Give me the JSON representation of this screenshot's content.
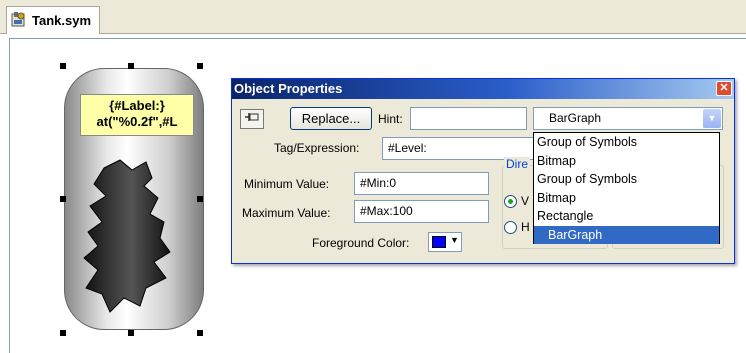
{
  "tab": {
    "title": "Tank.sym",
    "icon": "symbol-file-icon"
  },
  "symbol": {
    "label_line1": "{#Label:}",
    "label_line2": "at(\"%0.2f\",#L"
  },
  "dialog": {
    "title": "Object Properties",
    "replace_label": "Replace...",
    "hint_label": "Hint:",
    "hint_value": "",
    "object_type": "BarGraph",
    "tag_label": "Tag/Expression:",
    "tag_value": "#Level:",
    "min_label": "Minimum Value:",
    "min_value": "#Min:0",
    "max_label": "Maximum Value:",
    "max_value": "#Max:100",
    "fg_label": "Foreground Color:",
    "fg_color": "#0000ff",
    "direction_title": "Dire",
    "radio1_label": "V",
    "radio2_label": "H"
  },
  "dropdown": {
    "options": [
      "Group of Symbols",
      "Bitmap",
      "Group of Symbols",
      "Bitmap",
      "Rectangle",
      "BarGraph"
    ],
    "selected": "BarGraph"
  },
  "colors": {
    "title_bar": "#0a246a",
    "selection": "#316ac5",
    "label_bg": "#ffffa8"
  }
}
